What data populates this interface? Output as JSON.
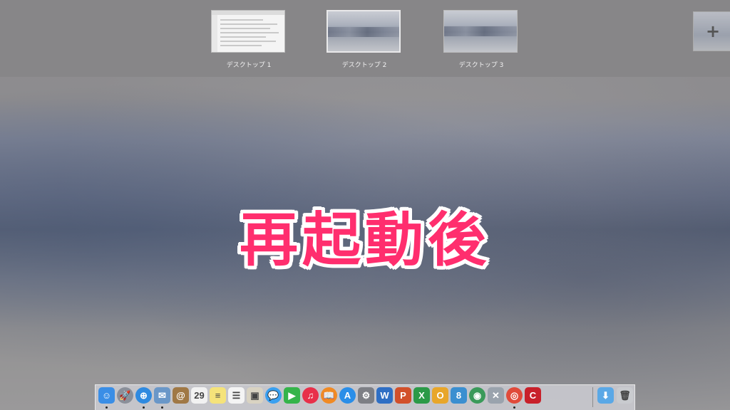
{
  "spaces": [
    {
      "label": "デスクトップ 1"
    },
    {
      "label": "デスクトップ 2"
    },
    {
      "label": "デスクトップ 3"
    }
  ],
  "add_space": {
    "glyph": "+"
  },
  "caption": "再起動後",
  "dock": {
    "apps": [
      {
        "name": "finder-icon",
        "color": "#3a8ee6",
        "glyph": "☺",
        "running": true
      },
      {
        "name": "launchpad-icon",
        "color": "#8a8f99",
        "glyph": "🚀",
        "running": false
      },
      {
        "name": "safari-icon",
        "color": "#2f8ae0",
        "glyph": "⊕",
        "running": true
      },
      {
        "name": "mail-icon",
        "color": "#6a97c8",
        "glyph": "✉",
        "running": true
      },
      {
        "name": "contacts-icon",
        "color": "#a07845",
        "glyph": "@",
        "running": false
      },
      {
        "name": "calendar-icon",
        "color": "#f2f2f2",
        "glyph": "29",
        "running": false
      },
      {
        "name": "notes-icon",
        "color": "#f5e37a",
        "glyph": "≡",
        "running": false
      },
      {
        "name": "reminders-icon",
        "color": "#f4f4f4",
        "glyph": "☰",
        "running": false
      },
      {
        "name": "preview-icon",
        "color": "#d9d3c2",
        "glyph": "▣",
        "running": false
      },
      {
        "name": "messages-icon",
        "color": "#3aa0f0",
        "glyph": "💬",
        "running": false
      },
      {
        "name": "facetime-icon",
        "color": "#35b44a",
        "glyph": "▶",
        "running": false
      },
      {
        "name": "itunes-icon",
        "color": "#e8304a",
        "glyph": "♫",
        "running": false
      },
      {
        "name": "ibooks-icon",
        "color": "#f08a24",
        "glyph": "📖",
        "running": false
      },
      {
        "name": "app-store-icon",
        "color": "#2a8ee8",
        "glyph": "A",
        "running": false
      },
      {
        "name": "system-preferences-icon",
        "color": "#7d7f85",
        "glyph": "⚙",
        "running": false
      },
      {
        "name": "word-icon",
        "color": "#2f6fc4",
        "glyph": "W",
        "running": false
      },
      {
        "name": "powerpoint-icon",
        "color": "#d2502a",
        "glyph": "P",
        "running": false
      },
      {
        "name": "excel-icon",
        "color": "#2c9a48",
        "glyph": "X",
        "running": false
      },
      {
        "name": "outlook-icon",
        "color": "#e8a62a",
        "glyph": "O",
        "running": false
      },
      {
        "name": "lync-icon",
        "color": "#3b8fd0",
        "glyph": "8",
        "running": false
      },
      {
        "name": "network-utility-icon",
        "color": "#3a9a5a",
        "glyph": "◉",
        "running": false
      },
      {
        "name": "scripts-icon",
        "color": "#9aa3ad",
        "glyph": "✕",
        "running": false
      },
      {
        "name": "chrome-icon",
        "color": "#e04a3a",
        "glyph": "◎",
        "running": true
      },
      {
        "name": "coke-icon",
        "color": "#c8202a",
        "glyph": "C",
        "running": false
      }
    ],
    "right": [
      {
        "name": "downloads-folder-icon",
        "color": "#5aa8e6",
        "glyph": "⬇"
      },
      {
        "name": "trash-icon",
        "color": "#c9cbcf",
        "glyph": "🗑"
      }
    ]
  }
}
